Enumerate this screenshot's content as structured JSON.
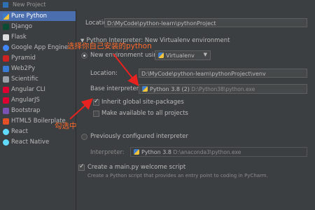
{
  "window": {
    "title": "New Project"
  },
  "sidebar": {
    "items": [
      {
        "label": "Pure Python",
        "color": "#f3c33c",
        "selected": true
      },
      {
        "label": "Django",
        "color": "#0c4b33"
      },
      {
        "label": "Flask",
        "color": "#dddddd"
      },
      {
        "label": "Google App Engine",
        "color": "#4285f4"
      },
      {
        "label": "Pyramid",
        "color": "#cc2222"
      },
      {
        "label": "Web2Py",
        "color": "#3a7bd5"
      },
      {
        "label": "Scientific",
        "color": "#9aa1a8"
      },
      {
        "label": "Angular CLI",
        "color": "#dd0031"
      },
      {
        "label": "AngularJS",
        "color": "#dd0031"
      },
      {
        "label": "Bootstrap",
        "color": "#7952b3"
      },
      {
        "label": "HTML5 Boilerplate",
        "color": "#e34f26"
      },
      {
        "label": "React",
        "color": "#61dafb"
      },
      {
        "label": "React Native",
        "color": "#61dafb"
      }
    ]
  },
  "form": {
    "location_label": "Location:",
    "location_value": "D:\\MyCode\\python-learn\\pythonProject",
    "interpreter_section": "Python Interpreter: New Virtualenv environment",
    "new_env_label": "New environment using",
    "env_tool": "Virtualenv",
    "venv_location_label": "Location:",
    "venv_location_value": "D:\\MyCode\\python-learn\\pythonProject\\venv",
    "base_interpreter_label": "Base interpreter:",
    "base_interpreter_name": "Python 3.8 (2)",
    "base_interpreter_path": "D:\\Python38\\python.exe",
    "inherit_label": "Inherit global site-packages",
    "make_available_label": "Make available to all projects",
    "prev_configured_label": "Previously configured interpreter",
    "interpreter_label": "Interpreter:",
    "interpreter_name": "Python 3.8",
    "interpreter_path": "D:\\anaconda3\\python.exe",
    "welcome_script_label": "Create a main.py welcome script",
    "welcome_script_desc": "Create a Python script that provides an entry point to coding in PyCharm."
  },
  "annotations": {
    "select_python": "选择你自己安装的python",
    "check_it": "勾选中",
    "color": "#ff6a2a"
  }
}
